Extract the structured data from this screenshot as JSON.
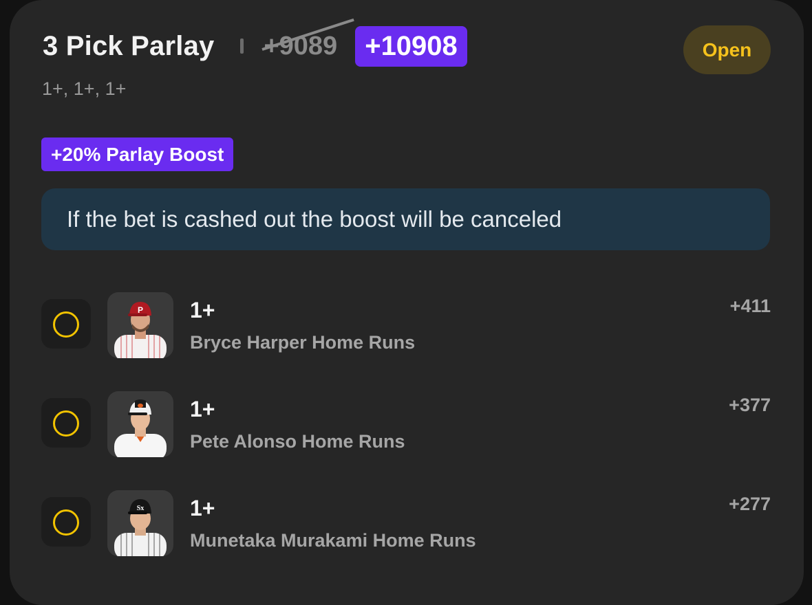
{
  "bet": {
    "title": "3 Pick Parlay",
    "original_odds": "+9089",
    "boosted_odds": "+10908",
    "status": "Open",
    "lines_summary": "1+, 1+, 1+",
    "boost_label": "+20% Parlay Boost",
    "notice": "If the bet is cashed out the boost will be canceled"
  },
  "legs": [
    {
      "line": "1+",
      "market": "Bryce Harper Home Runs",
      "odds": "+411",
      "cap_color": "#b01a22",
      "jersey": "pinstripe-red"
    },
    {
      "line": "1+",
      "market": "Pete Alonso Home Runs",
      "odds": "+377",
      "cap_color": "#f2f2f2",
      "jersey": "white"
    },
    {
      "line": "1+",
      "market": "Munetaka Murakami Home Runs",
      "odds": "+277",
      "cap_color": "#151515",
      "jersey": "pinstripe-black"
    }
  ],
  "colors": {
    "accent_purple": "#6a2cf0",
    "status_yellow": "#f6c21c",
    "notice_bg": "#1f3646"
  }
}
